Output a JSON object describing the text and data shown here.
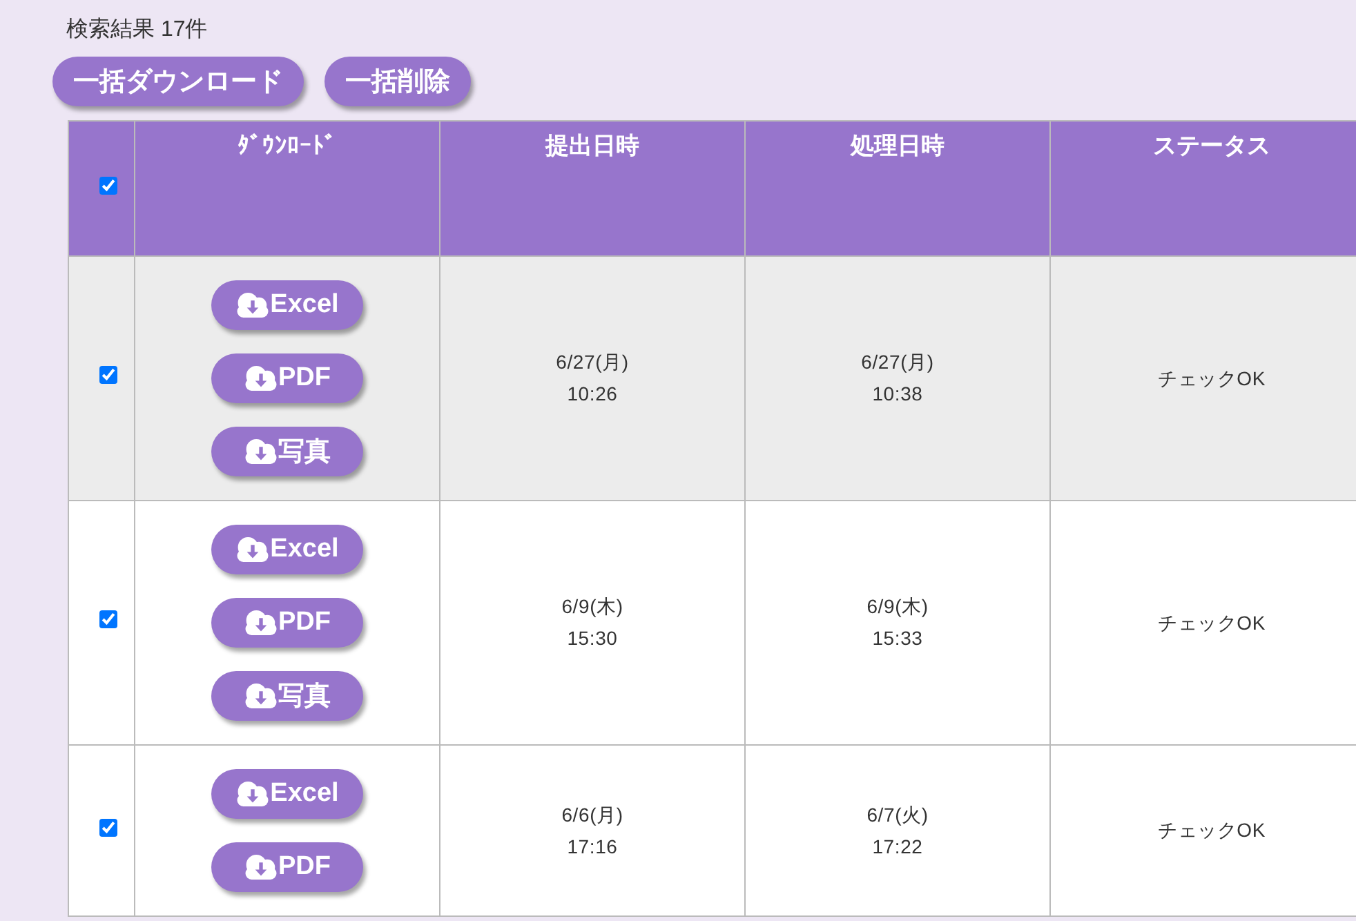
{
  "result_summary": "検索結果 17件",
  "bulk_buttons": [
    "一括ダウンロード",
    "一括削除"
  ],
  "table": {
    "select_all": {
      "checked": true
    },
    "columns": [
      "ﾀﾞｳﾝﾛｰﾄﾞ",
      "提出日時",
      "処理日時",
      "ステータス"
    ],
    "rows": [
      {
        "checked": true,
        "highlighted": true,
        "downloads": [
          "Excel",
          "PDF",
          "写真"
        ],
        "submitted": {
          "date": "6/27(月)",
          "time": "10:26"
        },
        "processed": {
          "date": "6/27(月)",
          "time": "10:38"
        },
        "status": "チェックOK"
      },
      {
        "checked": true,
        "highlighted": false,
        "downloads": [
          "Excel",
          "PDF",
          "写真"
        ],
        "submitted": {
          "date": "6/9(木)",
          "time": "15:30"
        },
        "processed": {
          "date": "6/9(木)",
          "time": "15:33"
        },
        "status": "チェックOK"
      },
      {
        "checked": true,
        "highlighted": false,
        "downloads": [
          "Excel",
          "PDF"
        ],
        "submitted": {
          "date": "6/6(月)",
          "time": "17:16"
        },
        "processed": {
          "date": "6/7(火)",
          "time": "17:22"
        },
        "status": "チェックOK"
      }
    ]
  }
}
